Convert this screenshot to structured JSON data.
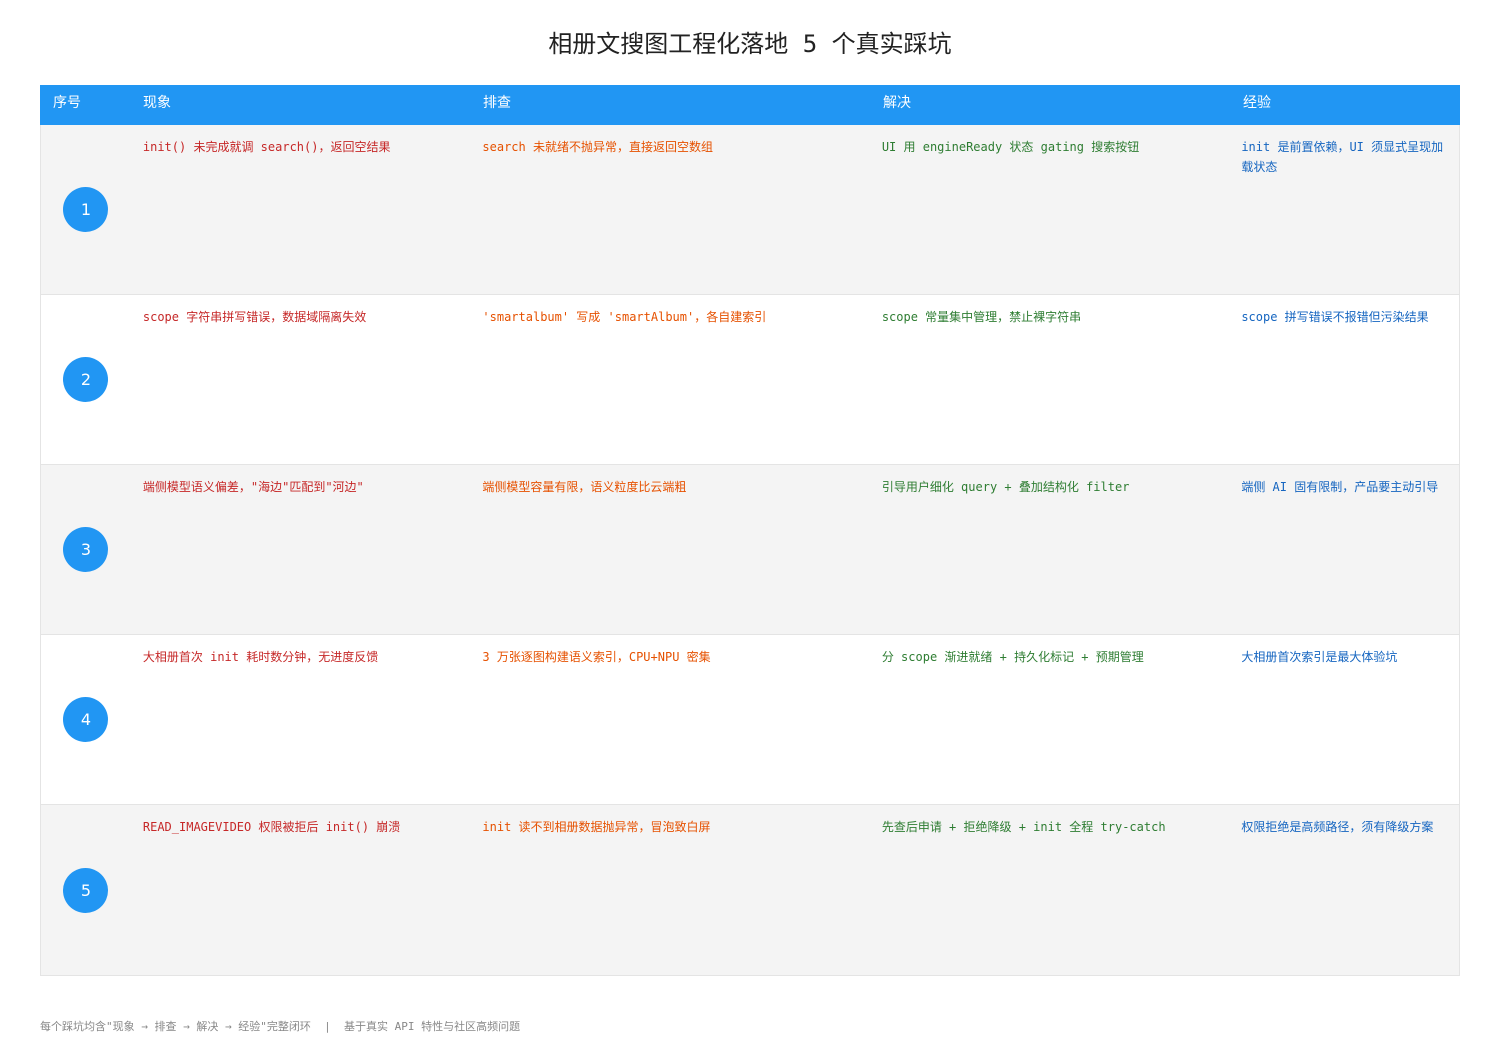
{
  "title": "相册文搜图工程化落地 5 个真实踩坑",
  "columns": [
    "序号",
    "现象",
    "排查",
    "解决",
    "经验"
  ],
  "rows": [
    {
      "num": "1",
      "phenomenon": "init() 未完成就调 search()，返回空结果",
      "investigation": "search 未就绪不抛异常，直接返回空数组",
      "solution": "UI 用 engineReady 状态 gating 搜索按钮",
      "lesson": "init 是前置依赖，UI 须显式呈现加载状态"
    },
    {
      "num": "2",
      "phenomenon": "scope 字符串拼写错误，数据域隔离失效",
      "investigation": "'smartalbum' 写成 'smartAlbum'，各自建索引",
      "solution": "scope 常量集中管理，禁止裸字符串",
      "lesson": "scope 拼写错误不报错但污染结果"
    },
    {
      "num": "3",
      "phenomenon": "端侧模型语义偏差，\"海边\"匹配到\"河边\"",
      "investigation": "端侧模型容量有限，语义粒度比云端粗",
      "solution": "引导用户细化 query + 叠加结构化 filter",
      "lesson": "端侧 AI 固有限制，产品要主动引导"
    },
    {
      "num": "4",
      "phenomenon": "大相册首次 init 耗时数分钟，无进度反馈",
      "investigation": "3 万张逐图构建语义索引，CPU+NPU 密集",
      "solution": "分 scope 渐进就绪 + 持久化标记 + 预期管理",
      "lesson": "大相册首次索引是最大体验坑"
    },
    {
      "num": "5",
      "phenomenon": "READ_IMAGEVIDEO 权限被拒后 init() 崩溃",
      "investigation": "init 读不到相册数据抛异常，冒泡致白屏",
      "solution": "先查后申请 + 拒绝降级 + init 全程 try-catch",
      "lesson": "权限拒绝是高频路径，须有降级方案"
    }
  ],
  "footer": "每个踩坑均含\"现象 → 排查 → 解决 → 经验\"完整闭环  |  基于真实 API 特性与社区高频问题"
}
